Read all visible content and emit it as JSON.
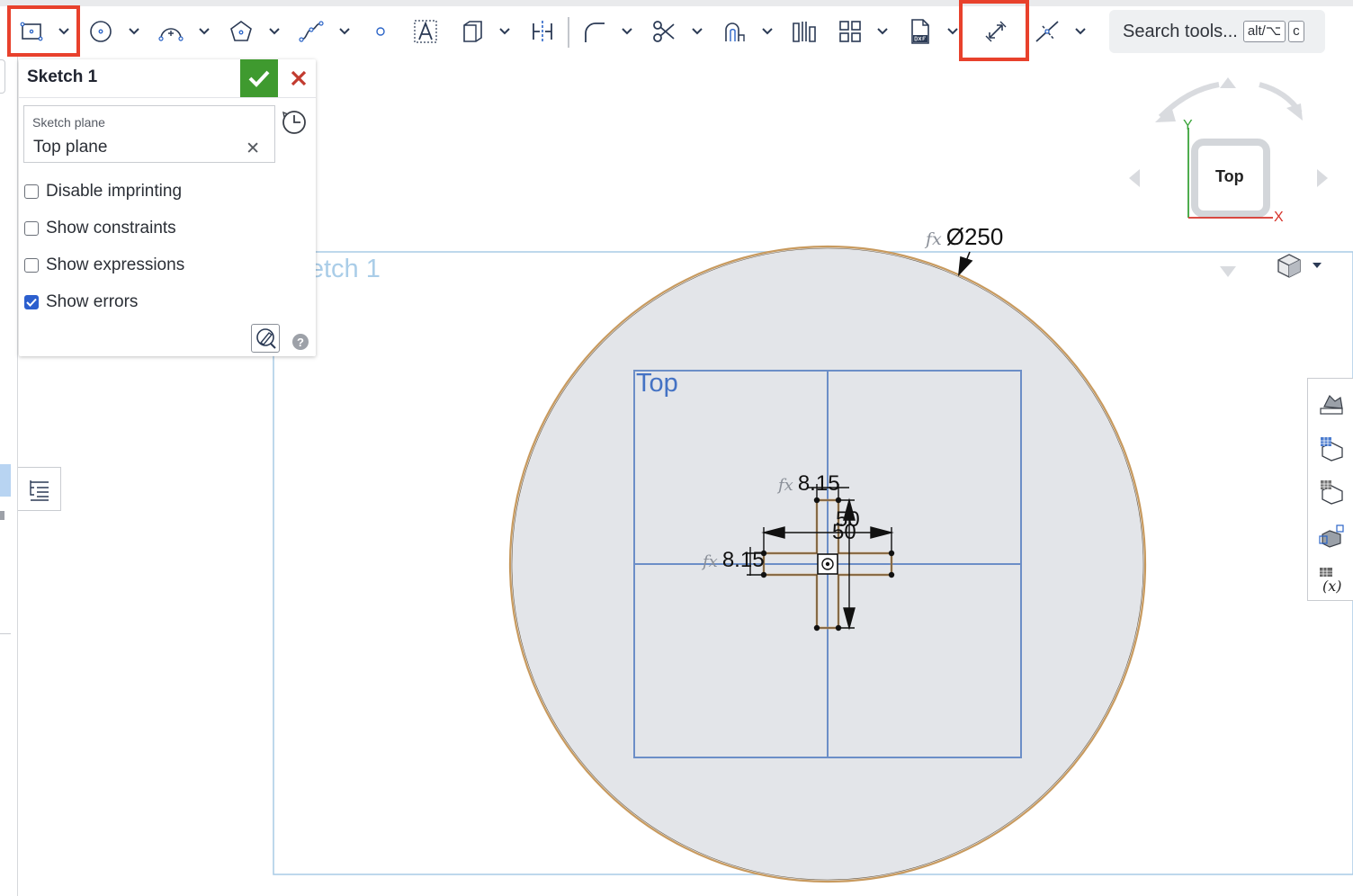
{
  "toolbar": {
    "icons": [
      "rectangle-icon",
      "circle-icon",
      "arc-icon",
      "polygon-icon",
      "spline-icon",
      "point-icon",
      "text-icon",
      "use-icon",
      "mirror-icon",
      "fillet-icon",
      "trim-icon",
      "offset-icon",
      "transform-icon",
      "pattern-icon",
      "dxf-icon",
      "dimension-icon",
      "construction-icon"
    ],
    "search_placeholder": "Search tools...",
    "search_kbd_1": "alt/⌥",
    "search_kbd_2": "c",
    "highlight_color": "#e8412c"
  },
  "panel": {
    "title": "Sketch 1",
    "plane_label": "Sketch plane",
    "plane_value": "Top plane",
    "options": [
      {
        "label": "Disable imprinting",
        "checked": false
      },
      {
        "label": "Show constraints",
        "checked": false
      },
      {
        "label": "Show expressions",
        "checked": false
      },
      {
        "label": "Show errors",
        "checked": true
      }
    ],
    "help": "?"
  },
  "viewport": {
    "sketch_name": "Sketch 1",
    "plane_name": "Top",
    "dimensions": {
      "diameter": "Ø250",
      "width_top": "8.15",
      "width_left": "8.15",
      "length_h": "50",
      "length_v": "50"
    },
    "fx_label": "fx"
  },
  "view_cube": {
    "face": "Top",
    "axis_y": "Y",
    "axis_x": "X",
    "y_color": "#3aa43a",
    "x_color": "#d6322a"
  },
  "sidebar": {
    "icons": [
      "appearance-icon",
      "section-view-icon",
      "mate-connector-icon",
      "display-states-icon",
      "variables-icon"
    ]
  }
}
